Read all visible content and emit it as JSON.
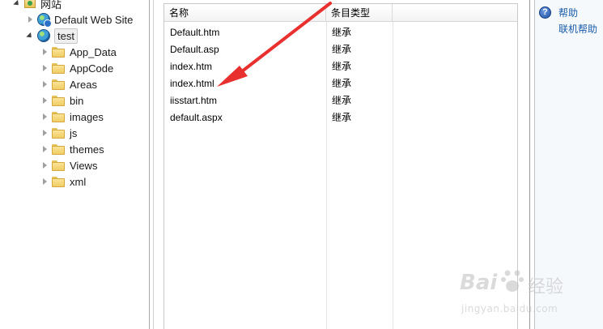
{
  "tree": {
    "root_label": "网站",
    "site_label": "Default Web Site",
    "selected_site_label": "test",
    "folders": [
      "App_Data",
      "AppCode",
      "Areas",
      "bin",
      "images",
      "js",
      "themes",
      "Views",
      "xml"
    ]
  },
  "list": {
    "columns": [
      "名称",
      "条目类型"
    ],
    "rows": [
      {
        "name": "Default.htm",
        "type": "继承"
      },
      {
        "name": "Default.asp",
        "type": "继承"
      },
      {
        "name": "index.htm",
        "type": "继承"
      },
      {
        "name": "index.html",
        "type": "继承"
      },
      {
        "name": "iisstart.htm",
        "type": "继承"
      },
      {
        "name": "default.aspx",
        "type": "继承"
      }
    ]
  },
  "actions": {
    "help_label": "帮助",
    "online_help_label": "联机帮助"
  },
  "colors": {
    "arrow": "#e8312f",
    "link": "#1a5ca8"
  },
  "watermark": {
    "brand": "Bai",
    "brand_cn": "经验",
    "url": "jingyan.baidu.com"
  }
}
